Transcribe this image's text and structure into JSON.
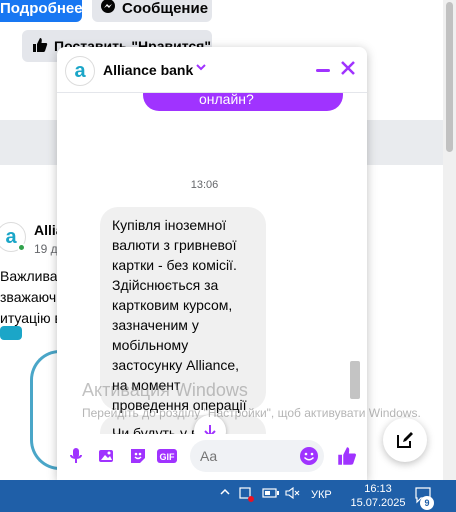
{
  "background": {
    "more_button": "Подробнее",
    "message_button": "Сообщение",
    "like_button": "Поставить \"Нравится\"",
    "post": {
      "author": "Allia",
      "date": "19 д",
      "text_lines": [
        "Важлива",
        "зважаючи",
        "итуацію в"
      ]
    }
  },
  "chat": {
    "title": "Alliance bank",
    "avatar_letter": "a",
    "outgoing_fragment": "онлайн?",
    "timestamp": "13:06",
    "incoming_message": "Купівля іноземної валюти з гривневої картки - без комісії. Здійснюється за картковим курсом, зазначеним  у мобільному застосунку Alliance, на момент  проведення операції",
    "incoming_message_2": "Чи будуть у в… додаткові запитання?",
    "input_placeholder": "Aa"
  },
  "watermark": {
    "title": "Активация Windows",
    "text": "Перейдіть до розділу \"Настройки\", щоб активувати Windows."
  },
  "taskbar": {
    "language": "УКР",
    "time": "16:13",
    "date": "15.07.2025",
    "notification_count": "9"
  },
  "colors": {
    "accent": "#a033ff",
    "facebook_blue": "#1877f2",
    "brand": "#1ba6c8",
    "taskbar": "#1f5fa8"
  }
}
